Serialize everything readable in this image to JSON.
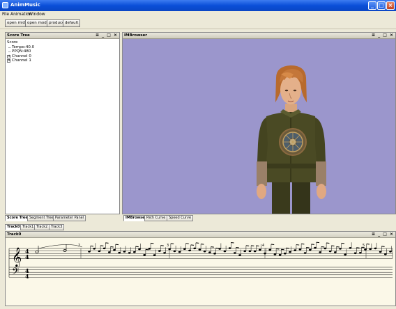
{
  "window": {
    "title": "AnimMusic"
  },
  "menu": [
    "File",
    "Animation",
    "Window"
  ],
  "toolbar": {
    "buttons": [
      "open midi",
      "open model",
      "produce",
      "default"
    ]
  },
  "score_panel": {
    "title": "Score Tree",
    "tree": {
      "root": "Score",
      "children": [
        "Tempo:40.0",
        "PPQN:480",
        "Channel 0",
        "Channel 1"
      ]
    },
    "tabs": [
      "Score Tree",
      "Segment Tree",
      "Parameter Panel"
    ]
  },
  "browser_panel": {
    "title": "IMBrowser",
    "tabs": [
      "IMBrowser",
      "Path Curve",
      "Speed Curve"
    ]
  },
  "panel_controls": "≡ _ □ ×",
  "track_tabs": [
    "Track0",
    "Track1",
    "Track2",
    "Track3"
  ],
  "track_panel": {
    "title": "Track0",
    "measure_numbers": [
      "2",
      "3",
      "4",
      "5"
    ],
    "time_signature": {
      "top": "4",
      "bottom": "4"
    }
  },
  "colors": {
    "titlebar": "#0a4fd8",
    "viewport_bg": "#9b96cc",
    "score_bg": "#fbf8e8"
  }
}
